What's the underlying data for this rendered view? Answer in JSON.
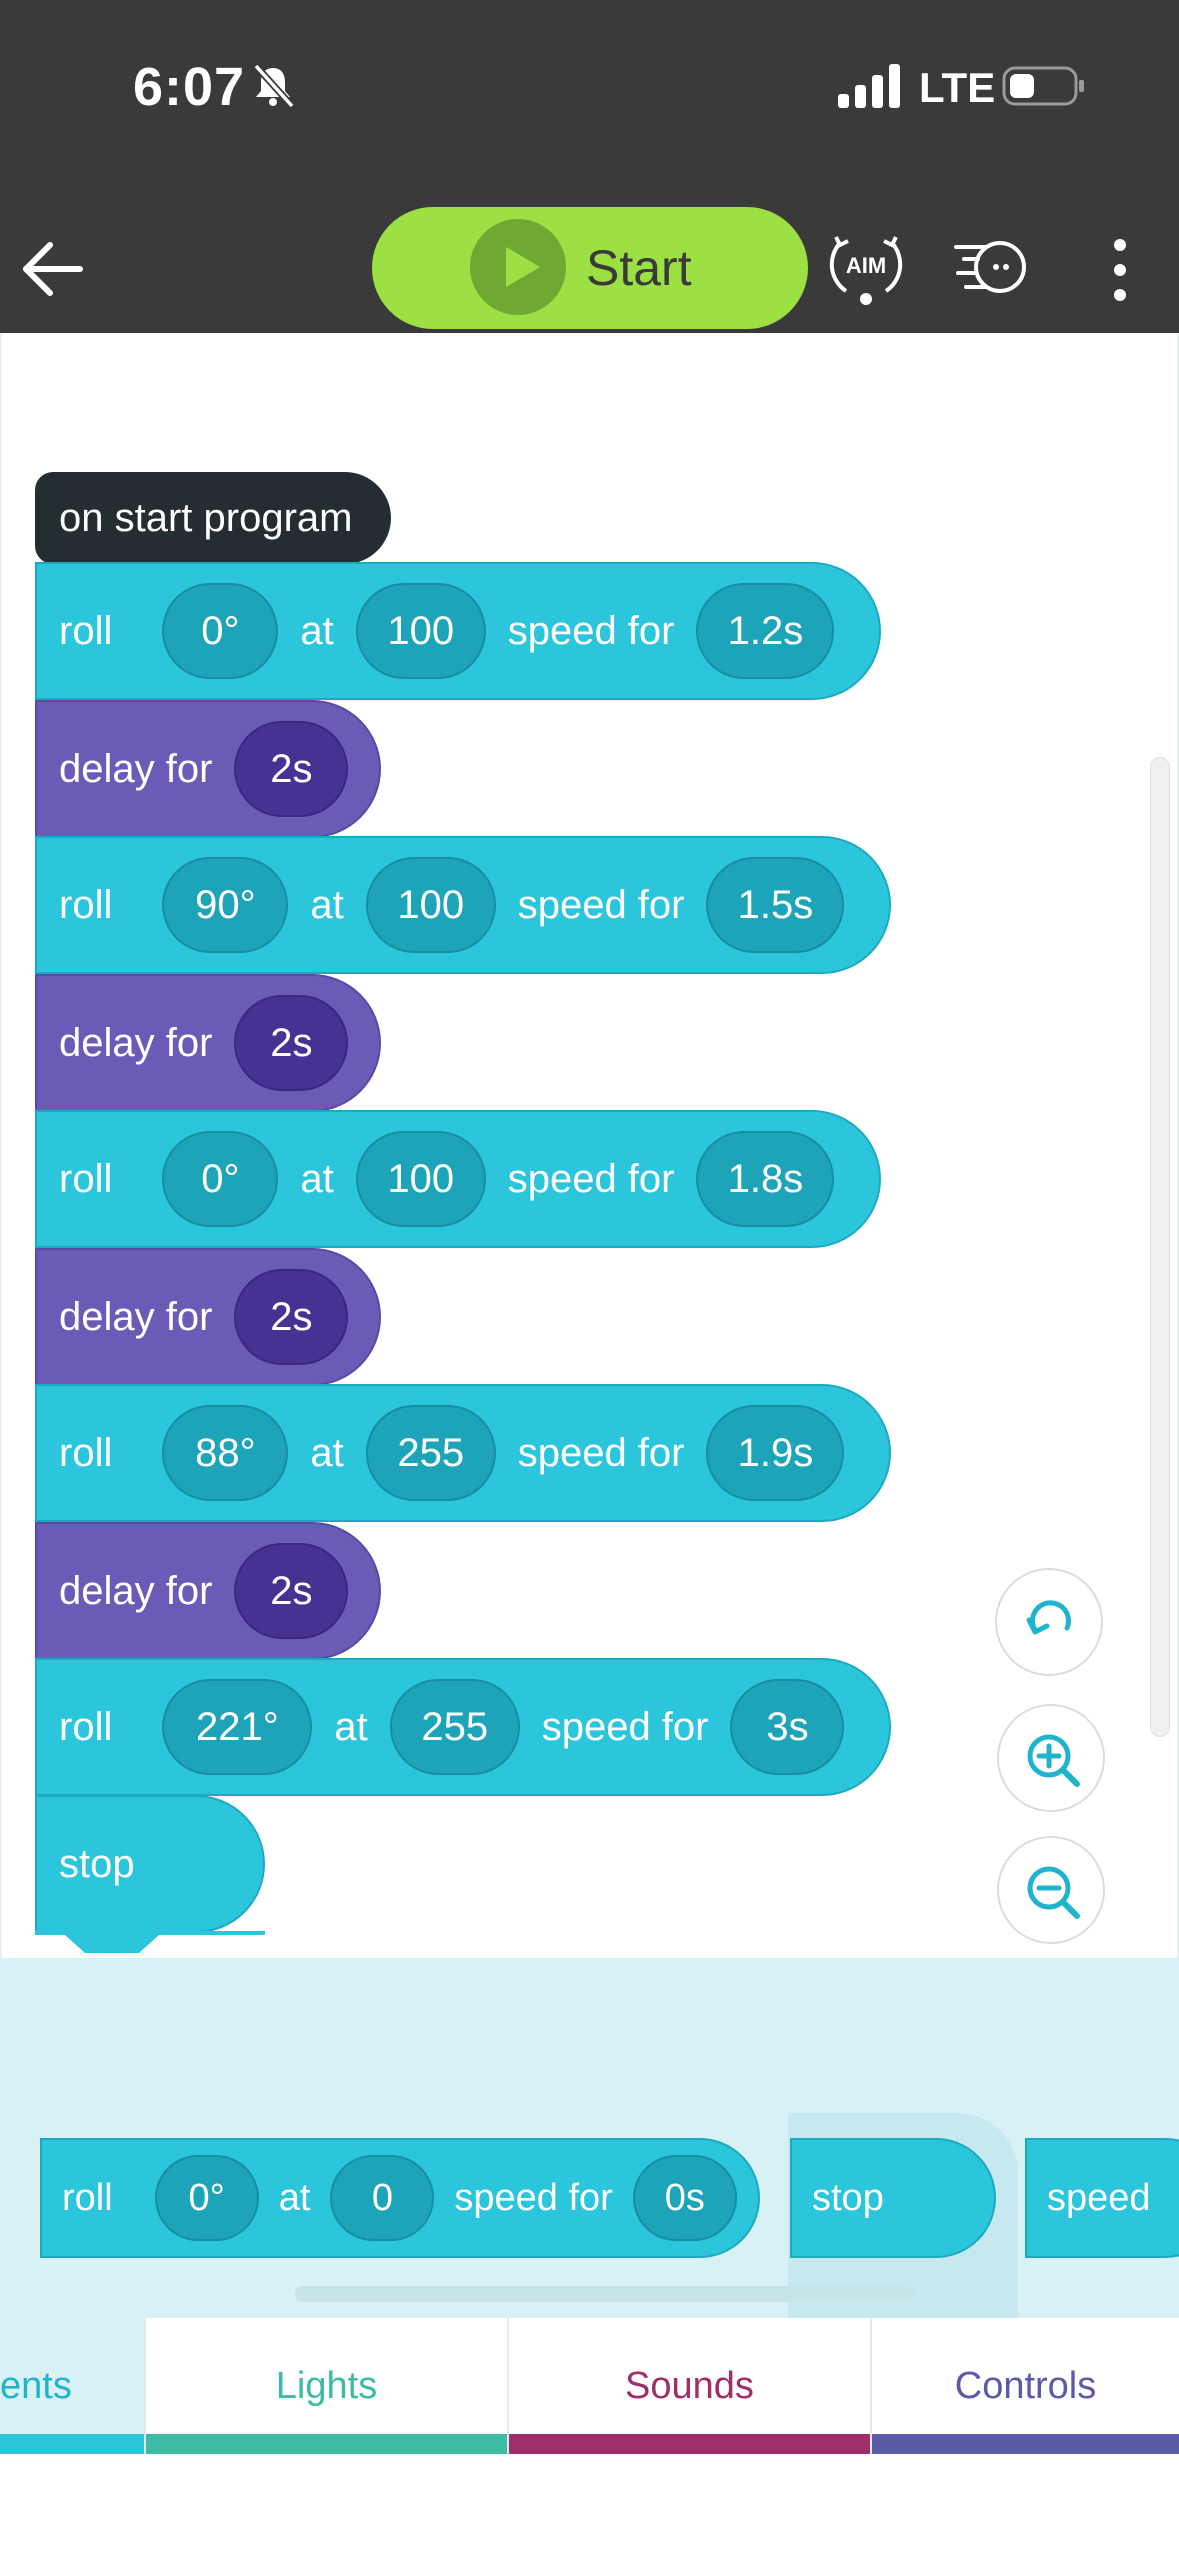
{
  "status": {
    "time": "6:07",
    "network": "LTE"
  },
  "toolbar": {
    "start_label": "Start",
    "aim_label": "AIM"
  },
  "program": {
    "hat": "on start program",
    "roll_kw": "roll",
    "at_kw": "at",
    "speed_kw": "speed for",
    "delay_kw": "delay for",
    "stop_kw": "stop",
    "rolls": [
      {
        "heading": "0°",
        "speed": "100",
        "duration": "1.2s"
      },
      {
        "heading": "90°",
        "speed": "100",
        "duration": "1.5s"
      },
      {
        "heading": "0°",
        "speed": "100",
        "duration": "1.8s"
      },
      {
        "heading": "88°",
        "speed": "255",
        "duration": "1.9s"
      },
      {
        "heading": "221°",
        "speed": "255",
        "duration": "3s"
      }
    ],
    "delays": [
      "2s",
      "2s",
      "2s",
      "2s"
    ]
  },
  "palette": {
    "roll": {
      "label": "roll",
      "heading": "0°",
      "at": "at",
      "speed": "0",
      "speed_for": "speed for",
      "duration": "0s"
    },
    "stop": "stop",
    "speed": "speed"
  },
  "tabs": [
    {
      "label": "ents",
      "color": "#2bc6dc"
    },
    {
      "label": "Lights",
      "color": "#3dbba5"
    },
    {
      "label": "Sounds",
      "color": "#9e2f6a"
    },
    {
      "label": "Controls",
      "color": "#5b5aa6"
    }
  ],
  "icons": [
    "back-arrow-icon",
    "play-icon",
    "aim-icon",
    "drive-icon",
    "more-icon",
    "undo-icon",
    "zoom-in-icon",
    "zoom-out-icon",
    "mute-bell-icon",
    "signal-icon",
    "battery-icon"
  ]
}
